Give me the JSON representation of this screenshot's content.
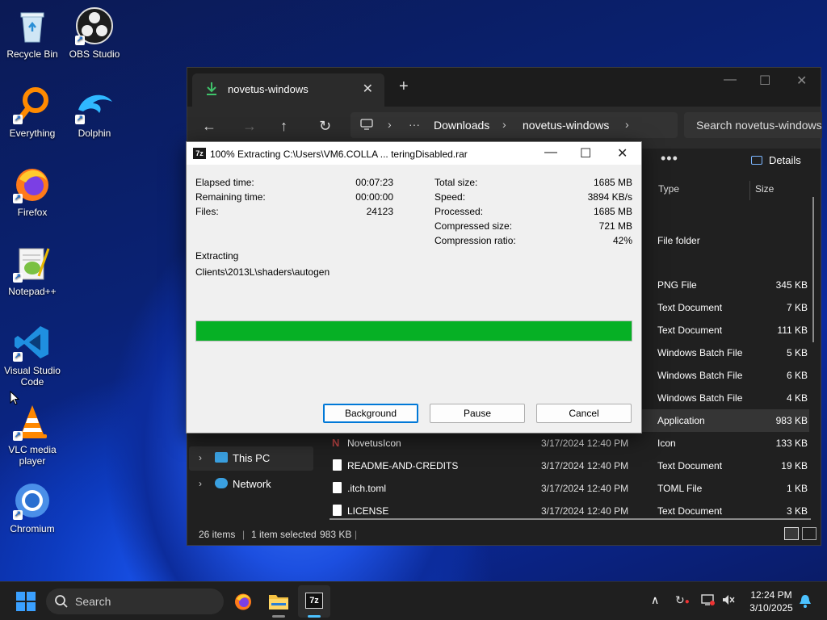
{
  "desktop": {
    "icons": [
      {
        "label": "Recycle Bin",
        "icon": "recycle-bin-icon"
      },
      {
        "label": "OBS Studio",
        "icon": "obs-studio-icon"
      },
      {
        "label": "Everything",
        "icon": "everything-search-icon"
      },
      {
        "label": "Dolphin",
        "icon": "dolphin-icon"
      },
      {
        "label": "Firefox",
        "icon": "firefox-icon"
      },
      {
        "label": "Notepad++",
        "icon": "notepad-plus-plus-icon"
      },
      {
        "label": "Visual Studio Code",
        "icon": "vscode-icon"
      },
      {
        "label": "VLC media player",
        "icon": "vlc-icon"
      },
      {
        "label": "Chromium",
        "icon": "chromium-icon"
      }
    ]
  },
  "explorer": {
    "tab_title": "novetus-windows",
    "breadcrumb": [
      "Downloads",
      "novetus-windows"
    ],
    "search_placeholder": "Search novetus-windows",
    "details_label": "Details",
    "columns": {
      "type": "Type",
      "size": "Size"
    },
    "partial_rows": [
      {
        "type": "File folder",
        "size": ""
      },
      {
        "type": "PNG File",
        "size": "345 KB"
      },
      {
        "type": "Text Document",
        "size": "7 KB"
      },
      {
        "type": "Text Document",
        "size": "111 KB"
      },
      {
        "type": "Windows Batch File",
        "size": "5 KB"
      },
      {
        "type": "Windows Batch File",
        "size": "6 KB"
      },
      {
        "type": "Windows Batch File",
        "size": "4 KB"
      },
      {
        "type": "Application",
        "size": "983 KB"
      }
    ],
    "rows": [
      {
        "name": "NovetusIcon",
        "date": "3/17/2024 12:40 PM",
        "type": "Icon",
        "size": "133 KB"
      },
      {
        "name": "README-AND-CREDITS",
        "date": "3/17/2024 12:40 PM",
        "type": "Text Document",
        "size": "19 KB"
      },
      {
        "name": ".itch.toml",
        "date": "3/17/2024 12:40 PM",
        "type": "TOML File",
        "size": "1 KB"
      },
      {
        "name": "LICENSE",
        "date": "3/17/2024 12:40 PM",
        "type": "Text Document",
        "size": "3 KB"
      }
    ],
    "nav": [
      {
        "label": "This PC"
      },
      {
        "label": "Network"
      }
    ],
    "status": {
      "count": "26 items",
      "selected": "1 item selected",
      "selected_size": "983 KB"
    }
  },
  "dialog": {
    "title": "100% Extracting C:\\Users\\VM6.COLLA ... teringDisabled.rar",
    "left_stats": [
      {
        "label": "Elapsed time:",
        "value": "00:07:23"
      },
      {
        "label": "Remaining time:",
        "value": "00:00:00"
      },
      {
        "label": "Files:",
        "value": "24123"
      }
    ],
    "right_stats": [
      {
        "label": "Total size:",
        "value": "1685 MB"
      },
      {
        "label": "Speed:",
        "value": "3894 KB/s"
      },
      {
        "label": "Processed:",
        "value": "1685 MB"
      },
      {
        "label": "Compressed size:",
        "value": "721 MB"
      },
      {
        "label": "Compression ratio:",
        "value": "42%"
      }
    ],
    "action_label": "Extracting",
    "current_path": "Clients\\2013L\\shaders\\autogen",
    "progress": 1.0,
    "progress_color": "#06b025",
    "buttons": {
      "background": "Background",
      "pause": "Pause",
      "cancel": "Cancel"
    }
  },
  "taskbar": {
    "search_label": "Search",
    "time": "12:24 PM",
    "date": "3/10/2025",
    "apps": [
      "firefox-icon",
      "file-explorer-icon",
      "7zip-icon"
    ]
  }
}
